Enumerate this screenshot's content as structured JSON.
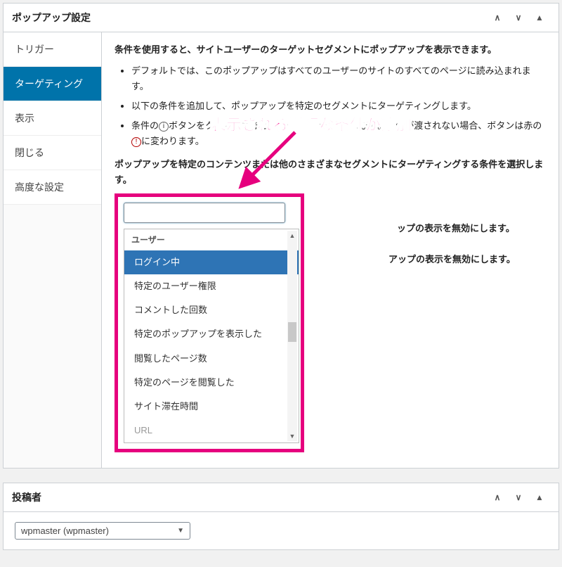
{
  "panel1": {
    "title": "ポップアップ設定",
    "chev_up_glyph": "∧",
    "chev_down_glyph": "∨",
    "tri_glyph": "▲"
  },
  "tabs": [
    {
      "label": "トリガー",
      "active": false
    },
    {
      "label": "ターゲティング",
      "active": true
    },
    {
      "label": "表示",
      "active": false
    },
    {
      "label": "閉じる",
      "active": false
    },
    {
      "label": "高度な設定",
      "active": false
    }
  ],
  "content": {
    "lead": "条件を使用すると、サイトユーザーのターゲットセグメントにポップアップを表示できます。",
    "bullets": [
      "デフォルトでは、このポップアップはすべてのユーザーのサイトのすべてのページに読み込まれます。",
      "以下の条件を追加して、ポップアップを特定のセグメントにターゲティングします。",
      "条件の●ボタンをクリックすると、条件がチェックされます。条件が渡されない場合、ボタンは赤の●に変わります。"
    ],
    "pick": "ポップアップを特定のコンテンツまたは他のさまざまなセグメントにターゲティングする条件を選択します。",
    "right1": "ップの表示を無効にします。",
    "right2": "アップの表示を無効にします。"
  },
  "dropdown": {
    "search_placeholder": "",
    "group": "ユーザー",
    "items": [
      {
        "label": "ログイン中",
        "selected": true
      },
      {
        "label": "特定のユーザー権限",
        "selected": false
      },
      {
        "label": "コメントした回数",
        "selected": false
      },
      {
        "label": "特定のポップアップを表示した",
        "selected": false
      },
      {
        "label": "閲覧したページ数",
        "selected": false
      },
      {
        "label": "特定のページを閲覧した",
        "selected": false
      },
      {
        "label": "サイト滞在時間",
        "selected": false
      }
    ],
    "cut_item": "URL"
  },
  "callout": {
    "text": "表示される詳細な条件が追加"
  },
  "panel2": {
    "title": "投稿者",
    "selected": "wpmaster (wpmaster)",
    "caret": "▼"
  }
}
